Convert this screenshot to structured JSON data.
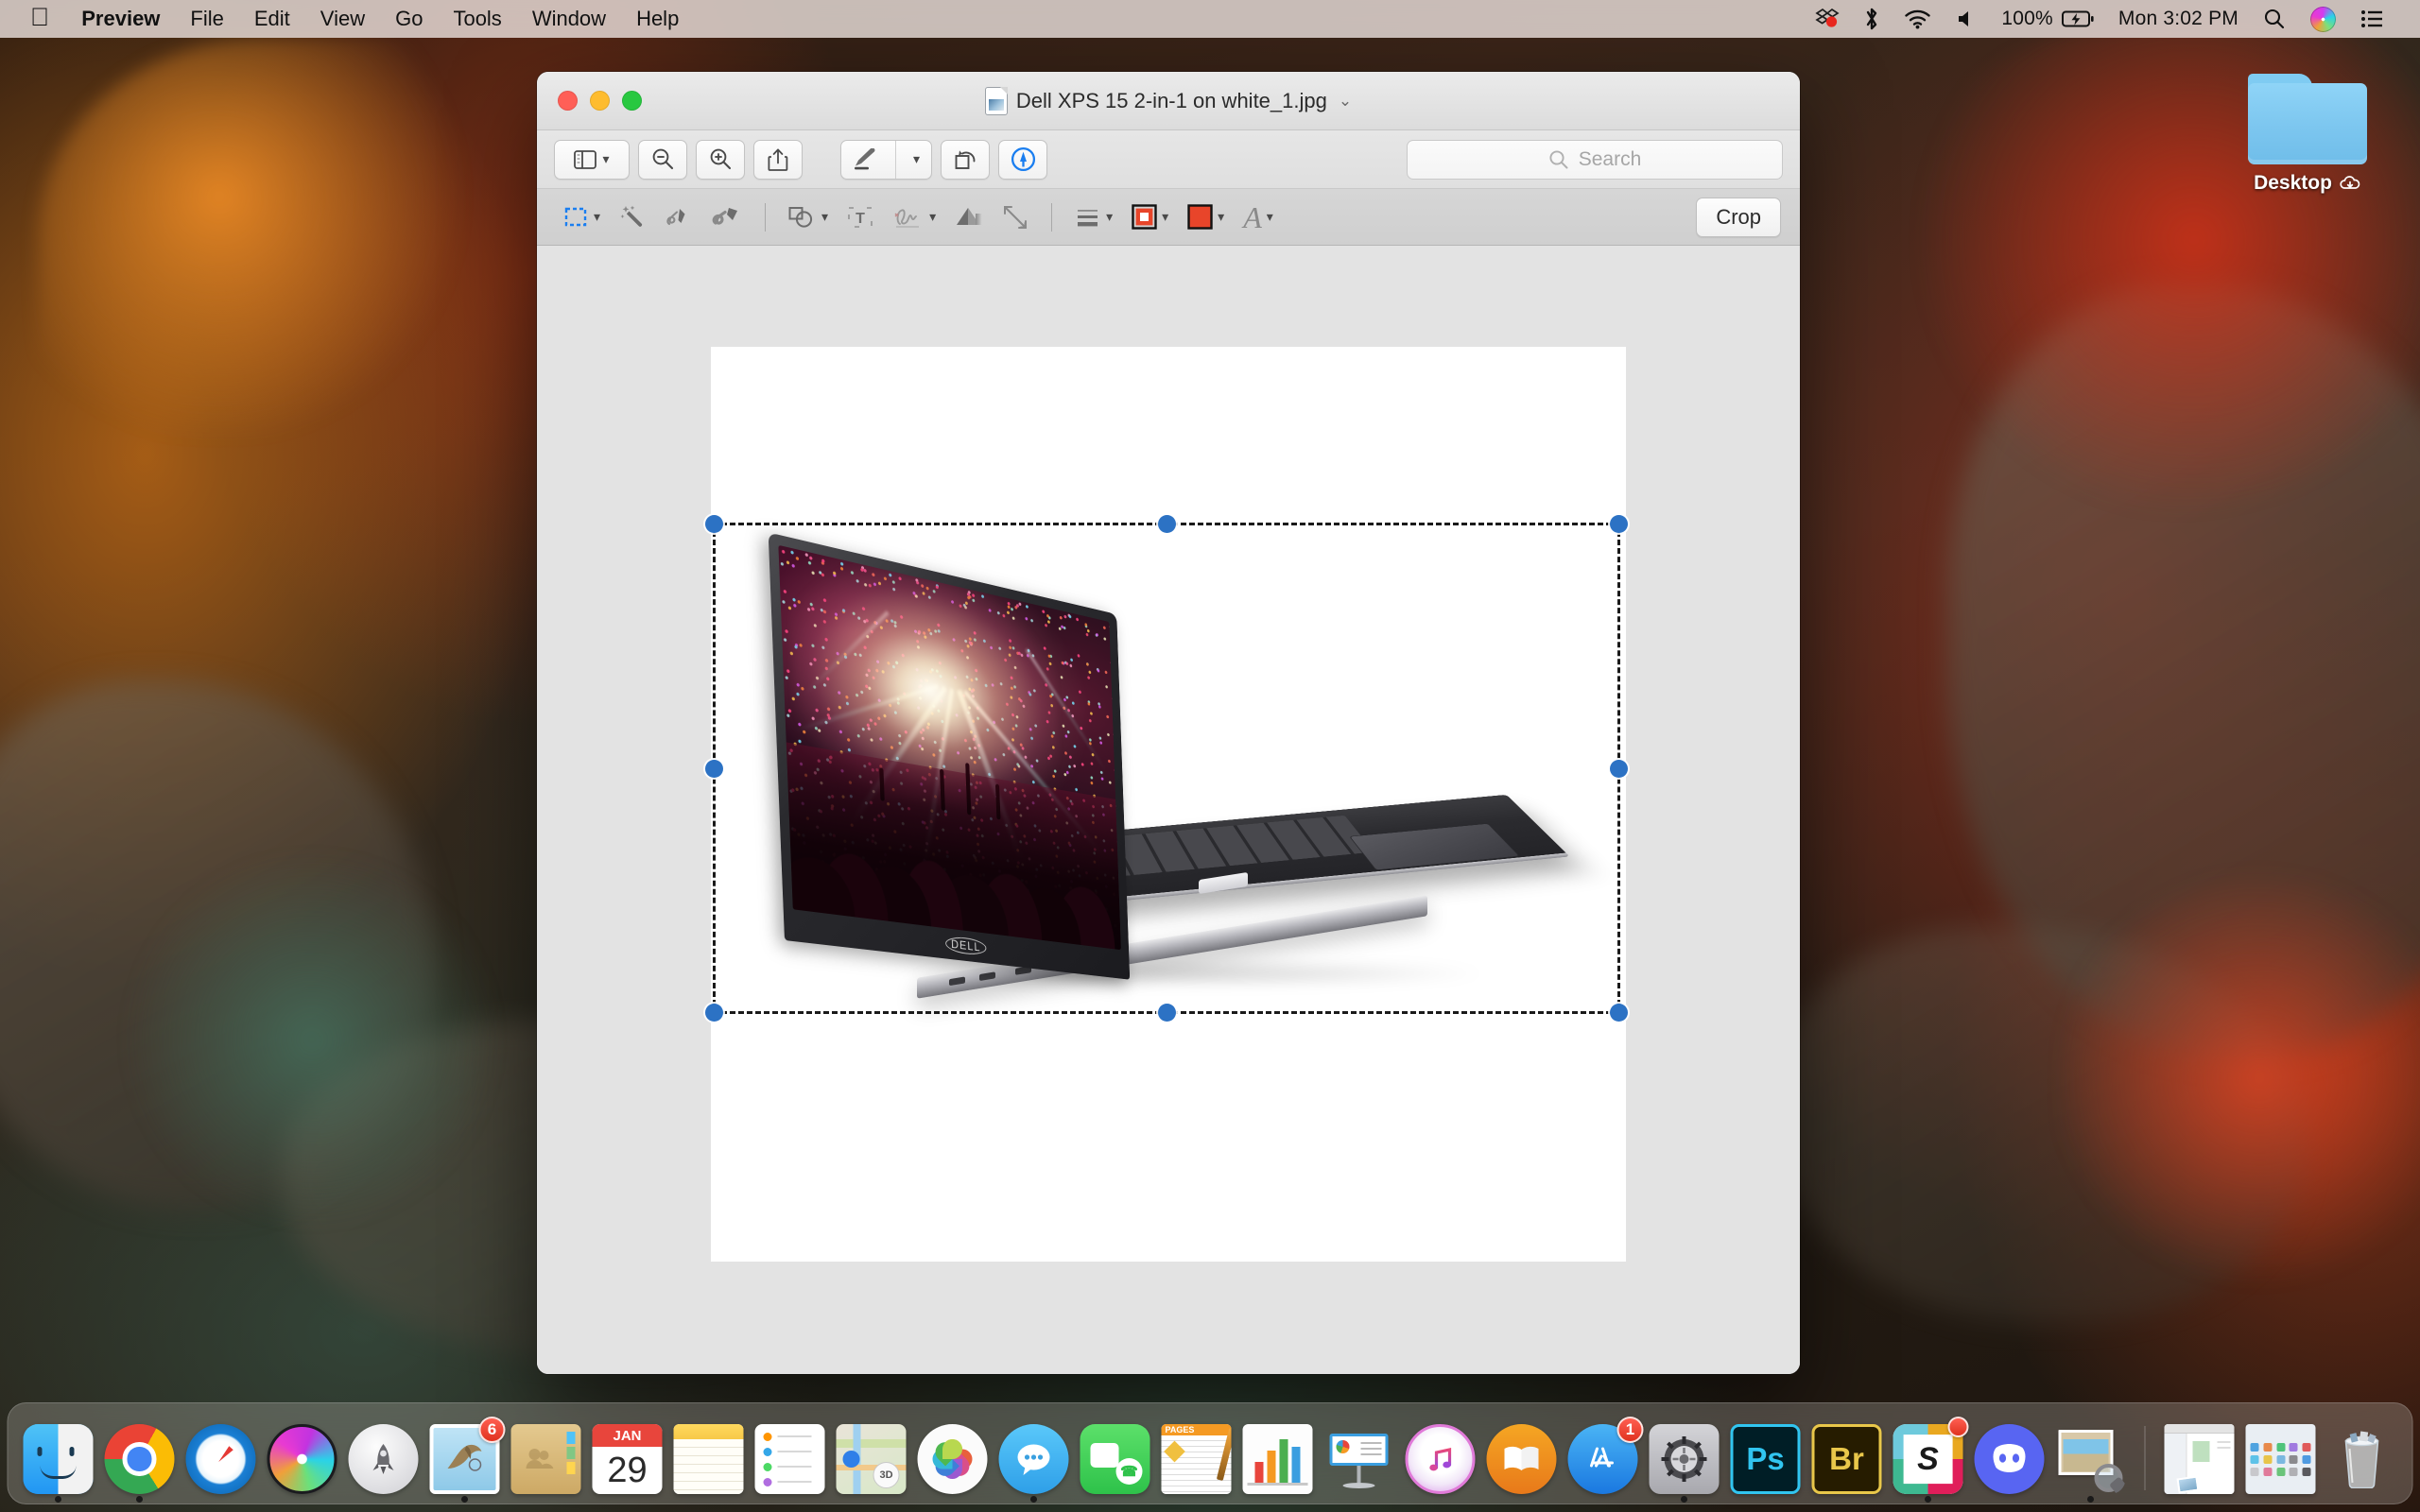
{
  "menubar": {
    "apple_icon": "apple-logo-icon",
    "items": [
      "Preview",
      "File",
      "Edit",
      "View",
      "Go",
      "Tools",
      "Window",
      "Help"
    ],
    "status": {
      "battery_percent": "100%",
      "datetime": "Mon 3:02 PM",
      "icons": [
        "dropbox-icon",
        "bluetooth-icon",
        "wifi-icon",
        "volume-icon",
        "battery-charging-icon",
        "spotlight-search-icon",
        "siri-icon",
        "control-center-icon"
      ]
    }
  },
  "desktop": {
    "icon_label": "Desktop",
    "icon_badge": "icloud-download-icon"
  },
  "window": {
    "title": "Dell XPS 15 2-in-1 on white_1.jpg",
    "title_chevron": "⌄",
    "traffic_lights": [
      "close-button",
      "minimize-button",
      "zoom-button"
    ],
    "toolbar": [
      {
        "name": "sidebar-toggle-button",
        "icon": "sidebar-icon",
        "has_chevron": true
      },
      {
        "name": "zoom-out-button",
        "icon": "zoom-out-icon",
        "has_chevron": false
      },
      {
        "name": "zoom-in-button",
        "icon": "zoom-in-icon",
        "has_chevron": false
      },
      {
        "name": "share-button",
        "icon": "share-icon",
        "has_chevron": false
      },
      {
        "name": "markup-pen-button",
        "icon": "highlighter-pen-icon",
        "has_chevron": true
      },
      {
        "name": "rotate-button",
        "icon": "rotate-left-icon",
        "has_chevron": false
      },
      {
        "name": "markup-toolbar-toggle",
        "icon": "markup-circle-icon",
        "has_chevron": false,
        "active": true
      }
    ],
    "search": {
      "placeholder": "Search",
      "icon": "search-icon",
      "value": ""
    },
    "markup_tools": [
      {
        "name": "selection-tool",
        "icon": "rectangular-selection-icon",
        "has_chevron": true,
        "active": true
      },
      {
        "name": "instant-alpha-tool",
        "icon": "magic-wand-icon",
        "has_chevron": false
      },
      {
        "name": "sketch-tool",
        "icon": "sketch-pencil-icon",
        "has_chevron": false
      },
      {
        "name": "draw-tool",
        "icon": "draw-marker-icon",
        "has_chevron": false
      },
      {
        "name": "shapes-tool",
        "icon": "shapes-icon",
        "has_chevron": true
      },
      {
        "name": "text-tool",
        "icon": "text-box-icon",
        "has_chevron": false
      },
      {
        "name": "signature-tool",
        "icon": "signature-icon",
        "has_chevron": true
      },
      {
        "name": "adjust-color-tool",
        "icon": "prism-icon",
        "has_chevron": false
      },
      {
        "name": "adjust-size-tool",
        "icon": "resize-arrows-icon",
        "has_chevron": false
      },
      {
        "name": "shape-style-tool",
        "icon": "line-weight-icon",
        "has_chevron": true
      },
      {
        "name": "border-color-tool",
        "icon": "border-color-swatch-icon",
        "has_chevron": true
      },
      {
        "name": "fill-color-tool",
        "icon": "fill-color-swatch-icon",
        "has_chevron": true
      },
      {
        "name": "text-style-tool",
        "icon": "font-style-a-icon",
        "has_chevron": true
      }
    ],
    "crop_label": "Crop",
    "colors": {
      "border_color": "#e8452a",
      "fill_color": "#e8452a",
      "markup_active": "#1a7ef0",
      "selection_handle": "#2c72c4"
    },
    "image": {
      "alt": "Dell XPS 15 2-in-1 laptop on white background",
      "brand_logo": "DELL",
      "selection_active": true
    }
  },
  "dock": {
    "items": [
      {
        "name": "finder",
        "label": "Finder",
        "running": true
      },
      {
        "name": "google-chrome",
        "label": "Google Chrome",
        "running": true
      },
      {
        "name": "safari",
        "label": "Safari",
        "running": false
      },
      {
        "name": "siri",
        "label": "Siri",
        "running": false
      },
      {
        "name": "launchpad",
        "label": "Launchpad",
        "running": false
      },
      {
        "name": "mail",
        "label": "Mail",
        "running": true,
        "badge": "6"
      },
      {
        "name": "contacts",
        "label": "Contacts",
        "running": false
      },
      {
        "name": "calendar",
        "label": "Calendar",
        "running": false,
        "month": "JAN",
        "day": "29"
      },
      {
        "name": "notes",
        "label": "Notes",
        "running": false
      },
      {
        "name": "reminders",
        "label": "Reminders",
        "running": false
      },
      {
        "name": "maps",
        "label": "Maps",
        "running": false
      },
      {
        "name": "photos",
        "label": "Photos",
        "running": false
      },
      {
        "name": "messages",
        "label": "Messages",
        "running": true
      },
      {
        "name": "facetime",
        "label": "FaceTime",
        "running": false
      },
      {
        "name": "pages",
        "label": "Pages",
        "running": false
      },
      {
        "name": "numbers",
        "label": "Numbers",
        "running": false
      },
      {
        "name": "keynote",
        "label": "Keynote",
        "running": false
      },
      {
        "name": "itunes",
        "label": "iTunes",
        "running": false
      },
      {
        "name": "books",
        "label": "Books",
        "running": false
      },
      {
        "name": "app-store",
        "label": "App Store",
        "running": false,
        "badge": "1"
      },
      {
        "name": "system-preferences",
        "label": "System Preferences",
        "running": true
      },
      {
        "name": "photoshop",
        "label": "Ps",
        "running": false
      },
      {
        "name": "bridge",
        "label": "Br",
        "running": false
      },
      {
        "name": "slack",
        "label": "Slack",
        "running": true,
        "badge": ""
      },
      {
        "name": "discord",
        "label": "Discord",
        "running": false
      },
      {
        "name": "preview",
        "label": "Preview",
        "running": true
      }
    ],
    "minimized": [
      {
        "name": "minimized-window-finder",
        "label": "Finder window"
      },
      {
        "name": "minimized-window-desktop",
        "label": "Desktop window"
      }
    ],
    "trash": {
      "name": "trash",
      "label": "Trash"
    }
  }
}
